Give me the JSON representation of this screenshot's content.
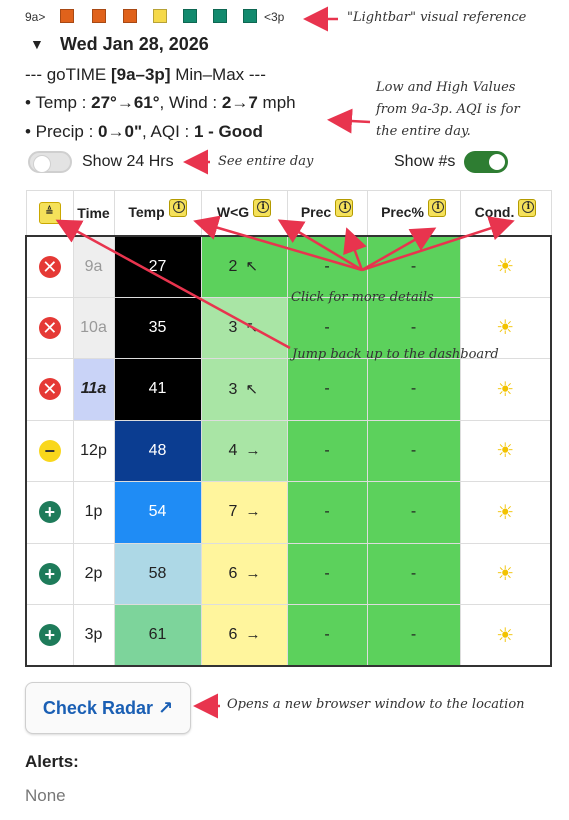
{
  "lightbar": {
    "start_label": "9a>",
    "end_label": "<3p",
    "colors": [
      "#e0621b",
      "#e0621b",
      "#e0621b",
      "#f5d94a",
      "#138a6e",
      "#138a6e",
      "#138a6e"
    ],
    "annotation": "\"Lightbar\" visual reference"
  },
  "date": {
    "collapse_glyph": "▼",
    "text": "Wed Jan 28, 2026"
  },
  "summary": {
    "title_pre": "--- goTIME ",
    "title_bold": "[9a–3p]",
    "title_post": " Min–Max ---",
    "temp_label": "• Temp : ",
    "temp_value": "27°→61°",
    "wind_label": ", Wind : ",
    "wind_value": "2→7",
    "wind_unit": " mph",
    "precip_label": "• Precip : ",
    "precip_value": "0→0\"",
    "aqi_label": ",  AQI : ",
    "aqi_value": "1 - Good",
    "annotation_1": "Low and High Values",
    "annotation_2": "from 9a-3p.  AQI is for",
    "annotation_3": "the entire day."
  },
  "toggles": {
    "show24_label": "Show 24 Hrs",
    "show24_on": false,
    "show24_note": "See entire day",
    "shownums_label": "Show #s",
    "shownums_on": true
  },
  "table": {
    "headers": {
      "jump": "≜",
      "time": "Time",
      "temp": "Temp",
      "wind": "W<G",
      "prec": "Prec",
      "precpct": "Prec%",
      "cond": "Cond."
    },
    "rows": [
      {
        "status": "x",
        "time": "9a",
        "temp": "27",
        "wind": "2",
        "wind_dir": "↖",
        "prec": "-",
        "precpct": "-",
        "cond": "☀",
        "temp_bg": "#000000",
        "wind_bg": "#5cd15c",
        "time_bg": "#eeeeee",
        "time_color": "#999999",
        "time_style": "normal"
      },
      {
        "status": "x",
        "time": "10a",
        "temp": "35",
        "wind": "3",
        "wind_dir": "↖",
        "prec": "-",
        "precpct": "-",
        "cond": "☀",
        "temp_bg": "#000000",
        "wind_bg": "#a9e5a5",
        "time_bg": "#eeeeee",
        "time_color": "#999999",
        "time_style": "normal"
      },
      {
        "status": "x",
        "time": "11a",
        "temp": "41",
        "wind": "3",
        "wind_dir": "↖",
        "prec": "-",
        "precpct": "-",
        "cond": "☀",
        "temp_bg": "#000000",
        "wind_bg": "#a9e5a5",
        "time_bg": "#c9d3f7",
        "time_color": "#222222",
        "time_style": "italic-bold"
      },
      {
        "status": "minus",
        "time": "12p",
        "temp": "48",
        "wind": "4",
        "wind_dir": "→",
        "prec": "-",
        "precpct": "-",
        "cond": "☀",
        "temp_bg": "#0b3d91",
        "wind_bg": "#a9e5a5",
        "time_bg": "#ffffff",
        "time_color": "#222222",
        "time_style": "normal"
      },
      {
        "status": "plus",
        "time": "1p",
        "temp": "54",
        "wind": "7",
        "wind_dir": "→",
        "prec": "-",
        "precpct": "-",
        "cond": "☀",
        "temp_bg": "#1f8cf5",
        "wind_bg": "#fff59d",
        "time_bg": "#ffffff",
        "time_color": "#222222",
        "time_style": "normal"
      },
      {
        "status": "plus",
        "time": "2p",
        "temp": "58",
        "wind": "6",
        "wind_dir": "→",
        "prec": "-",
        "precpct": "-",
        "cond": "☀",
        "temp_bg": "#add8e6",
        "wind_bg": "#fff59d",
        "time_bg": "#ffffff",
        "time_color": "#222222",
        "time_style": "normal"
      },
      {
        "status": "plus",
        "time": "3p",
        "temp": "61",
        "wind": "6",
        "wind_dir": "→",
        "prec": "-",
        "precpct": "-",
        "cond": "☀",
        "temp_bg": "#7dd49b",
        "wind_bg": "#fff59d",
        "time_bg": "#ffffff",
        "time_color": "#222222",
        "time_style": "normal"
      }
    ],
    "prec_bg": "#5cd15c",
    "note_click": "Click for more details",
    "note_jump": "Jump back up to the dashboard"
  },
  "radar": {
    "label": "Check Radar ↗",
    "note": "Opens a new browser window to the location"
  },
  "alerts": {
    "heading": "Alerts:",
    "value": "None"
  },
  "colors": {
    "annotation_arrow": "#e8344e",
    "toggle_on": "#2e7d32",
    "link": "#1a5fb4"
  }
}
